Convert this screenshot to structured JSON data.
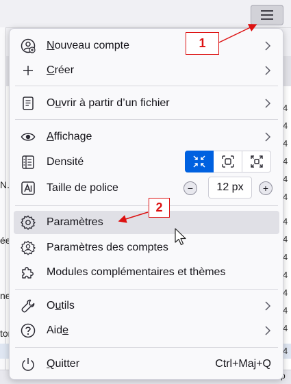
{
  "menu": {
    "new_account": {
      "label_first": "N",
      "label_rest": "ouveau compte"
    },
    "create": {
      "label_first": "C",
      "label_rest": "réer"
    },
    "open_file": {
      "label_before": "O",
      "label_access": "u",
      "label_rest": "vrir à partir d’un fichier"
    },
    "view": {
      "label_first": "A",
      "label_rest": "ffichage"
    },
    "density": {
      "label": "Densité"
    },
    "font_size": {
      "label": "Taille de police",
      "decrease": "−",
      "value": "12 px",
      "increase": "+"
    },
    "settings": {
      "label": "Paramètres"
    },
    "account_settings": {
      "label": "Paramètres des comptes"
    },
    "addons": {
      "label": "Modules complémentaires et thèmes"
    },
    "tools": {
      "label_before": "O",
      "label_access": "u",
      "label_rest": "tils"
    },
    "help": {
      "label_before": "Aid",
      "label_access": "e",
      "label_rest": ""
    },
    "quit": {
      "label_first": "Q",
      "label_rest": "uitter",
      "shortcut": "Ctrl+Maj+Q"
    }
  },
  "callouts": {
    "one": "1",
    "two": "2"
  },
  "background": {
    "left_fragments": [
      "N.",
      "ée",
      "ne",
      "ton"
    ],
    "right_fragments": [
      "4",
      "4",
      "4",
      "4",
      "4",
      "4",
      "4",
      "4",
      "4",
      "4",
      "4",
      "4",
      "4",
      "4"
    ],
    "footer_fragment": "Jp"
  },
  "colors": {
    "accent": "#0061e0",
    "callout": "#dd1111",
    "highlight": "#e0e0e6"
  }
}
